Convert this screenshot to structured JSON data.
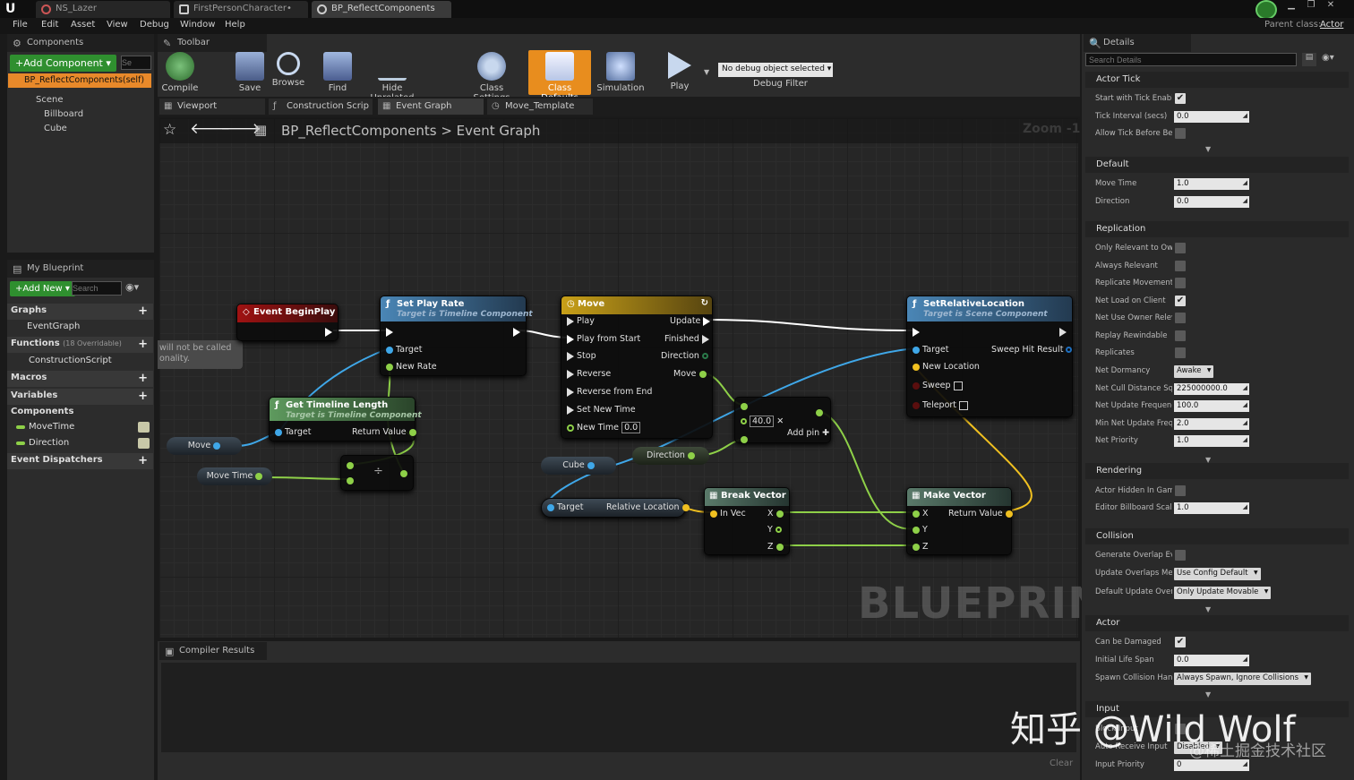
{
  "window": {
    "tabs": [
      "NS_Lazer",
      "FirstPersonCharacter•",
      "BP_ReflectComponents"
    ],
    "parent_class_label": "Parent class:",
    "parent_class": "Actor"
  },
  "menu": [
    "File",
    "Edit",
    "Asset",
    "View",
    "Debug",
    "Window",
    "Help"
  ],
  "components": {
    "title": "Components",
    "add_label": "+Add Component ▾",
    "search_placeholder": "Se",
    "self_item": "BP_ReflectComponents(self)",
    "tree": [
      "Scene",
      "Billboard",
      "Cube"
    ]
  },
  "toolbar": {
    "title": "Toolbar",
    "buttons": [
      "Compile",
      "Save",
      "Browse",
      "Find",
      "Hide Unrelated",
      "Class Settings",
      "Class Defaults",
      "Simulation",
      "Play"
    ],
    "debug_select": "No debug object selected",
    "debug_label": "Debug Filter"
  },
  "editor_tabs": [
    "Viewport",
    "Construction Scrip",
    "Event Graph",
    "Move_Template"
  ],
  "breadcrumb": {
    "root": "BP_ReflectComponents",
    "sep": ">",
    "leaf": "Event Graph",
    "zoom": "Zoom -1"
  },
  "my_blueprint": {
    "title": "My Blueprint",
    "add_label": "+Add New ▾",
    "search_placeholder": "Search",
    "graphs_label": "Graphs",
    "graph_item": "EventGraph",
    "functions_label": "Functions",
    "functions_note": "(18 Overridable)",
    "function_item": "ConstructionScript",
    "macros_label": "Macros",
    "variables_label": "Variables",
    "components_label": "Components",
    "var_items": [
      "MoveTime",
      "Direction"
    ],
    "dispatchers_label": "Event Dispatchers"
  },
  "graph": {
    "watermark": "BLUEPRINT",
    "comment_lines": [
      "will not be called",
      "onality."
    ],
    "event_begin": "Event BeginPlay",
    "set_play_rate": {
      "title": "Set Play Rate",
      "subtitle": "Target is Timeline Component",
      "pins": [
        "Target",
        "New Rate"
      ]
    },
    "get_timeline_length": {
      "title": "Get Timeline Length",
      "subtitle": "Target is Timeline Component",
      "in": "Target",
      "out": "Return Value"
    },
    "move_timeline": {
      "title": "Move",
      "left": [
        "Play",
        "Play from Start",
        "Stop",
        "Reverse",
        "Reverse from End",
        "Set New Time",
        "New Time"
      ],
      "right": [
        "Update",
        "Finished",
        "Direction",
        "Move"
      ],
      "new_time_value": "0.0"
    },
    "vars": {
      "move": "Move",
      "move_time": "Move Time",
      "cube": "Cube",
      "direction": "Direction"
    },
    "divide": "÷",
    "multiply": {
      "value": "40.0",
      "add_pin": "Add pin"
    },
    "get_rel": {
      "in": "Target",
      "out": "Relative Location"
    },
    "break_vector": {
      "title": "Break Vector",
      "in": "In Vec",
      "outs": [
        "X",
        "Y",
        "Z"
      ]
    },
    "make_vector": {
      "title": "Make Vector",
      "ins": [
        "X",
        "Y",
        "Z"
      ],
      "out": "Return Value"
    },
    "set_rel_loc": {
      "title": "SetRelativeLocation",
      "subtitle": "Target is Scene Component",
      "pins": [
        "Target",
        "New Location",
        "Sweep",
        "Teleport"
      ],
      "out": "Sweep Hit Result"
    }
  },
  "compiler": {
    "title": "Compiler Results",
    "clear": "Clear"
  },
  "details": {
    "title": "Details",
    "search_placeholder": "Search Details",
    "sections": [
      {
        "name": "Actor Tick",
        "rows": [
          {
            "label": "Start with Tick Enabl",
            "type": "check",
            "on": true
          },
          {
            "label": "Tick Interval (secs)",
            "type": "field",
            "value": "0.0"
          },
          {
            "label": "Allow Tick Before Be",
            "type": "check",
            "on": false
          }
        ]
      },
      {
        "name": "Default",
        "rows": [
          {
            "label": "Move Time",
            "type": "field",
            "value": "1.0"
          },
          {
            "label": "Direction",
            "type": "field",
            "value": "0.0"
          }
        ]
      },
      {
        "name": "Replication",
        "rows": [
          {
            "label": "Only Relevant to Owr",
            "type": "check",
            "on": false
          },
          {
            "label": "Always Relevant",
            "type": "check",
            "on": false
          },
          {
            "label": "Replicate Movement",
            "type": "check",
            "on": false
          },
          {
            "label": "Net Load on Client",
            "type": "check",
            "on": true
          },
          {
            "label": "Net Use Owner Relev",
            "type": "check",
            "on": false
          },
          {
            "label": "Replay Rewindable",
            "type": "check",
            "on": false
          },
          {
            "label": "Replicates",
            "type": "check",
            "on": false
          },
          {
            "label": "Net Dormancy",
            "type": "dd",
            "value": "Awake"
          },
          {
            "label": "Net Cull Distance Sq",
            "type": "field",
            "value": "225000000.0"
          },
          {
            "label": "Net Update Frequenc",
            "type": "field",
            "value": "100.0"
          },
          {
            "label": "Min Net Update Frequ",
            "type": "field",
            "value": "2.0"
          },
          {
            "label": "Net Priority",
            "type": "field",
            "value": "1.0"
          }
        ]
      },
      {
        "name": "Rendering",
        "rows": [
          {
            "label": "Actor Hidden In Gam",
            "type": "check",
            "on": false
          },
          {
            "label": "Editor Billboard Scale",
            "type": "field",
            "value": "1.0"
          }
        ]
      },
      {
        "name": "Collision",
        "rows": [
          {
            "label": "Generate Overlap Eve",
            "type": "check",
            "on": false
          },
          {
            "label": "Update Overlaps Met",
            "type": "dd",
            "value": "Use Config Default"
          },
          {
            "label": "Default Update Overl",
            "type": "dd",
            "value": "Only Update Movable"
          }
        ]
      },
      {
        "name": "Actor",
        "rows": [
          {
            "label": "Can be Damaged",
            "type": "check",
            "on": true
          },
          {
            "label": "Initial Life Span",
            "type": "field",
            "value": "0.0"
          },
          {
            "label": "Spawn Collision Hand",
            "type": "dd",
            "value": "Always Spawn, Ignore Collisions"
          }
        ]
      },
      {
        "name": "Input",
        "rows": [
          {
            "label": "Block Input",
            "type": "check",
            "on": false
          },
          {
            "label": "Auto Receive Input",
            "type": "dd",
            "value": "Disabled"
          },
          {
            "label": "Input Priority",
            "type": "field",
            "value": "0"
          }
        ]
      }
    ]
  },
  "watermark": {
    "main": "知乎 @Wild Wolf",
    "sub": "@稀土掘金技术社区"
  }
}
